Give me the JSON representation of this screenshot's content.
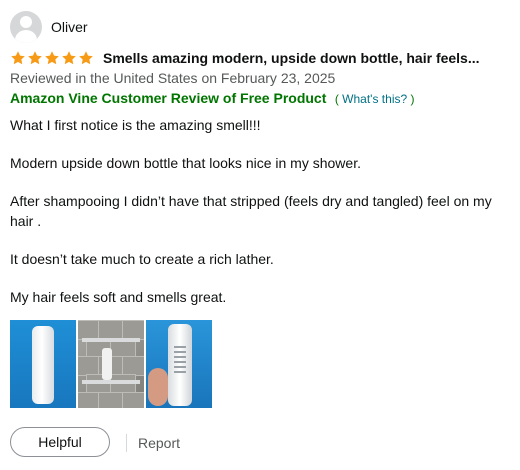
{
  "review": {
    "reviewer": {
      "name": "Oliver",
      "avatar_icon": "default-avatar-icon"
    },
    "rating": {
      "stars": 5,
      "max": 5,
      "color": "#f79a16"
    },
    "title": "Smells amazing modern, upside down bottle, hair feels...",
    "date": "Reviewed in the United States on February 23, 2025",
    "vine": {
      "label": "Amazon Vine Customer Review of Free Product",
      "open_paren": "(",
      "whats_this": "What's this?",
      "close_paren": ")"
    },
    "body": [
      "What I first notice is the amazing smell!!!",
      "Modern upside down bottle that looks nice in my shower.",
      "After shampooing I didn’t have that stripped (feels dry and tangled) feel on my hair .",
      "It doesn’t take much to create a rich lather.",
      "My hair feels soft and smells great."
    ],
    "images_count": 3,
    "actions": {
      "helpful": "Helpful",
      "report": "Report"
    }
  },
  "colors": {
    "vine_green": "#007600",
    "link_teal": "#007185",
    "secondary_text": "#565959"
  }
}
